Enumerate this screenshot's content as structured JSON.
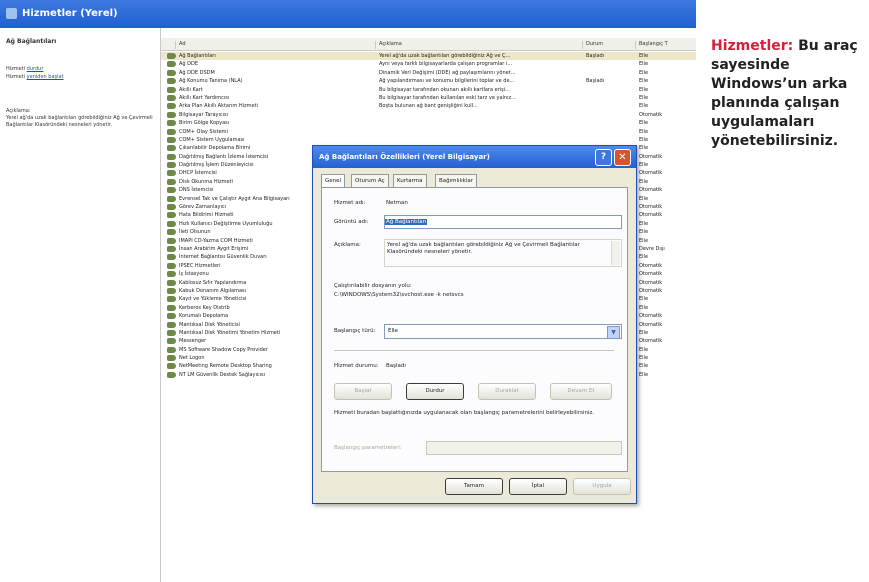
{
  "main_window": {
    "title": "Hizmetler (Yerel)"
  },
  "left_pane": {
    "heading": "Ağ Bağlantıları",
    "service_prefix": "Hizmeti",
    "stop_link": "durdur",
    "restart_link": "yeniden başlat",
    "desc_label": "Açıklama:",
    "description": "Yerel ağ'da uzak bağlantıları görebildiğiniz Ağ ve Çevirmeli Bağlantılar Klasöründeki nesneleri yönetir."
  },
  "list": {
    "columns": [
      "Ad",
      "Açıklama",
      "Durum",
      "Başlangıç T"
    ],
    "rows": [
      {
        "name": "Ağ Bağlantıları",
        "desc": "Yerel ağ'da uzak bağlantıları görebildiğiniz Ağ ve Ç...",
        "status": "Başladı",
        "start": "Elle"
      },
      {
        "name": "Ağ DDE",
        "desc": "Aynı veya farklı bilgisayarlarda çalışan programlar i...",
        "status": "",
        "start": "Elle"
      },
      {
        "name": "Ağ DDE DSDM",
        "desc": "Dinamik Veri Değişimi (DDE) ağ paylaşımlarını yönet...",
        "status": "",
        "start": "Elle"
      },
      {
        "name": "Ağ Konumu Tanıma (NLA)",
        "desc": "Ağ yapılandırması ve konumu bilgilerini toplar ve de...",
        "status": "Başladı",
        "start": "Elle"
      },
      {
        "name": "Akıllı Kart",
        "desc": "Bu bilgisayar tarafından okunan akıllı kartlara erişi...",
        "status": "",
        "start": "Elle"
      },
      {
        "name": "Akıllı Kart Yardımcısı",
        "desc": "Bu bilgisayar tarafından kullanılan eski tarz ve yalnız...",
        "status": "",
        "start": "Elle"
      },
      {
        "name": "Arka Plan Akıllı Aktarım Hizmeti",
        "desc": "Boşta bulunan ağ bant genişliğini kull...",
        "status": "",
        "start": "Elle"
      },
      {
        "name": "Bilgisayar Tarayıcısı",
        "desc": "",
        "status": "",
        "start": "Otomatik"
      },
      {
        "name": "Birim Gölge Kopyası",
        "desc": "",
        "status": "",
        "start": "Elle"
      },
      {
        "name": "COM+ Olay Sistemi",
        "desc": "",
        "status": "",
        "start": "Elle"
      },
      {
        "name": "COM+ Sistem Uygulaması",
        "desc": "",
        "status": "",
        "start": "Elle"
      },
      {
        "name": "Çıkarılabilir Depolama Birimi",
        "desc": "",
        "status": "",
        "start": "Elle"
      },
      {
        "name": "Dağıtılmış Bağlantı İzleme İstemcisi",
        "desc": "",
        "status": "",
        "start": "Otomatik"
      },
      {
        "name": "Dağıtılmış İşlem Düzenleyicisi",
        "desc": "",
        "status": "",
        "start": "Elle"
      },
      {
        "name": "DHCP İstemcisi",
        "desc": "",
        "status": "",
        "start": "Otomatik"
      },
      {
        "name": "Disk Okunma Hizmeti",
        "desc": "",
        "status": "",
        "start": "Elle"
      },
      {
        "name": "DNS İstemcisi",
        "desc": "",
        "status": "",
        "start": "Otomatik"
      },
      {
        "name": "Evrensel Tak ve Çalıştır Aygıt Ana Bilgisayarı",
        "desc": "",
        "status": "",
        "start": "Elle"
      },
      {
        "name": "Görev Zamanlayıcı",
        "desc": "",
        "status": "",
        "start": "Otomatik"
      },
      {
        "name": "Hata Bildirimi Hizmeti",
        "desc": "",
        "status": "",
        "start": "Otomatik"
      },
      {
        "name": "Hızlı Kullanıcı Değiştirme Uyumluluğu",
        "desc": "",
        "status": "",
        "start": "Elle"
      },
      {
        "name": "İleti Olsunun",
        "desc": "",
        "status": "",
        "start": "Elle"
      },
      {
        "name": "IMAPI CD-Yazma COM Hizmeti",
        "desc": "",
        "status": "",
        "start": "Elle"
      },
      {
        "name": "İnsan Arabirim Aygıt Erişimi",
        "desc": "",
        "status": "",
        "start": "Devre Dışı"
      },
      {
        "name": "Internet Bağlantısı Güvenlik Duvarı",
        "desc": "",
        "status": "",
        "start": "Elle"
      },
      {
        "name": "IPSEC Hizmetleri",
        "desc": "",
        "status": "",
        "start": "Otomatik"
      },
      {
        "name": "İş İstasyonu",
        "desc": "",
        "status": "",
        "start": "Otomatik"
      },
      {
        "name": "Kablosuz Sıfır Yapılandırma",
        "desc": "",
        "status": "",
        "start": "Otomatik"
      },
      {
        "name": "Kabuk Donanım Algılaması",
        "desc": "",
        "status": "",
        "start": "Otomatik"
      },
      {
        "name": "Kayıt ve Yükleme Yöneticisi",
        "desc": "",
        "status": "",
        "start": "Elle"
      },
      {
        "name": "Kerberos Key Distrib",
        "desc": "",
        "status": "",
        "start": "Elle"
      },
      {
        "name": "Korumalı Depolama",
        "desc": "",
        "status": "",
        "start": "Otomatik"
      },
      {
        "name": "Mantıksal Disk Yöneticisi",
        "desc": "",
        "status": "",
        "start": "Otomatik"
      },
      {
        "name": "Mantıksal Disk Yönetimi Yönetim Hizmeti",
        "desc": "",
        "status": "",
        "start": "Elle"
      },
      {
        "name": "Messenger",
        "desc": "İstemciler ve sunucular arasındaki Net Send ve Uyar...",
        "status": "Başladı",
        "start": "Otomatik"
      },
      {
        "name": "MS Software Shadow Copy Provider",
        "desc": "Birim Gölge Kopyası hizmeti tarafından alınan yazılım...",
        "status": "",
        "start": "Elle"
      },
      {
        "name": "Net Logon",
        "desc": "Etki alanı içindeki bilgisayarlar için, hesapların oturu...",
        "status": "",
        "start": "Elle"
      },
      {
        "name": "NetMeeting Remote Desktop Sharing",
        "desc": "Yetkili kişilerin NetMeeting yoluyla Windows masas...",
        "status": "",
        "start": "Elle"
      },
      {
        "name": "NT LM Güvenlik Destek Sağlayıcısı",
        "desc": "Adlandırılmış yöneltme dışındaki aktarımlar kullanan...",
        "status": "",
        "start": "Elle"
      }
    ]
  },
  "dialog": {
    "title": "Ağ Bağlantıları Özellikleri (Yerel Bilgisayar)",
    "tabs": [
      "Genel",
      "Oturum Aç",
      "Kurtarma",
      "Bağımlılıklar"
    ],
    "service_name_label": "Hizmet adı:",
    "service_name_value": "Netman",
    "display_name_label": "Görüntü adı:",
    "display_name_value": "Ağ Bağlantıları",
    "description_label": "Açıklama:",
    "description_value": "Yerel ağ'da uzak bağlantıları görebildiğiniz Ağ ve Çevirmeli Bağlantılar Klasöründeki nesneleri yönetir.",
    "exe_path_label": "Çalıştırılabilir dosyanın yolu:",
    "exe_path_value": "C:\\WINDOWS\\System32\\svchost.exe -k netsvcs",
    "startup_type_label": "Başlangıç türü:",
    "startup_type_value": "Elle",
    "status_label": "Hizmet durumu:",
    "status_value": "Başladı",
    "start_button": "Başlat",
    "stop_button": "Durdur",
    "pause_button": "Duraklat",
    "resume_button": "Devam Et",
    "params_note": "Hizmeti buradan başlattığınızda uygulanacak olan başlangıç parametrelerini belirleyebilirsiniz.",
    "params_label": "Başlangıç parametreleri:",
    "ok_button": "Tamam",
    "cancel_button": "İptal",
    "apply_button": "Uygula"
  },
  "caption": {
    "keyword": "Hizmetler:",
    "text": " Bu araç sayesinde Windows’un arka planında çalışan uygulamaları yönetebilirsiniz."
  }
}
